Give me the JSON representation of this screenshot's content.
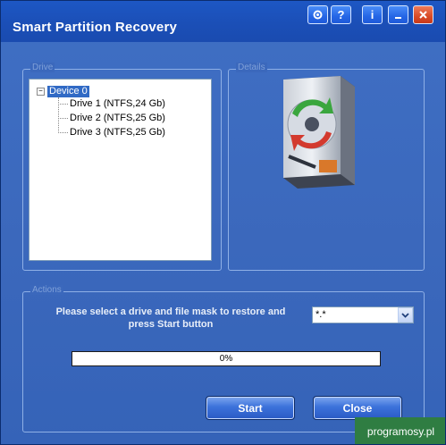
{
  "window": {
    "title": "Smart Partition Recovery"
  },
  "titlebar_buttons": [
    {
      "name": "settings-icon",
      "glyph": "⚙"
    },
    {
      "name": "help-icon",
      "glyph": "?"
    },
    {
      "name": "info-icon",
      "glyph": "i"
    },
    {
      "name": "minimize-icon",
      "glyph": "_"
    },
    {
      "name": "close-icon",
      "glyph": "x"
    }
  ],
  "drive_panel": {
    "legend": "Drive",
    "tree": {
      "root": {
        "expander": "−",
        "label": "Device 0"
      },
      "children": [
        "Drive 1 (NTFS,24 Gb)",
        "Drive 2 (NTFS,25 Gb)",
        "Drive 3 (NTFS,25 Gb)"
      ]
    }
  },
  "details_panel": {
    "legend": "Details",
    "image": "hard-drive-recovery-icon"
  },
  "actions_panel": {
    "legend": "Actions",
    "instruction": "Please select a drive and file mask to restore and press Start button",
    "file_mask": "*.*",
    "progress": {
      "percent": 0,
      "label": "0%"
    }
  },
  "buttons": {
    "start": "Start",
    "close": "Close"
  },
  "watermark": {
    "text": "programosy.pl",
    "color": "#2f7d42"
  },
  "colors": {
    "window_bg": "#3b68bc",
    "titlebar": "#1b4fb7",
    "selection": "#316ac5"
  }
}
